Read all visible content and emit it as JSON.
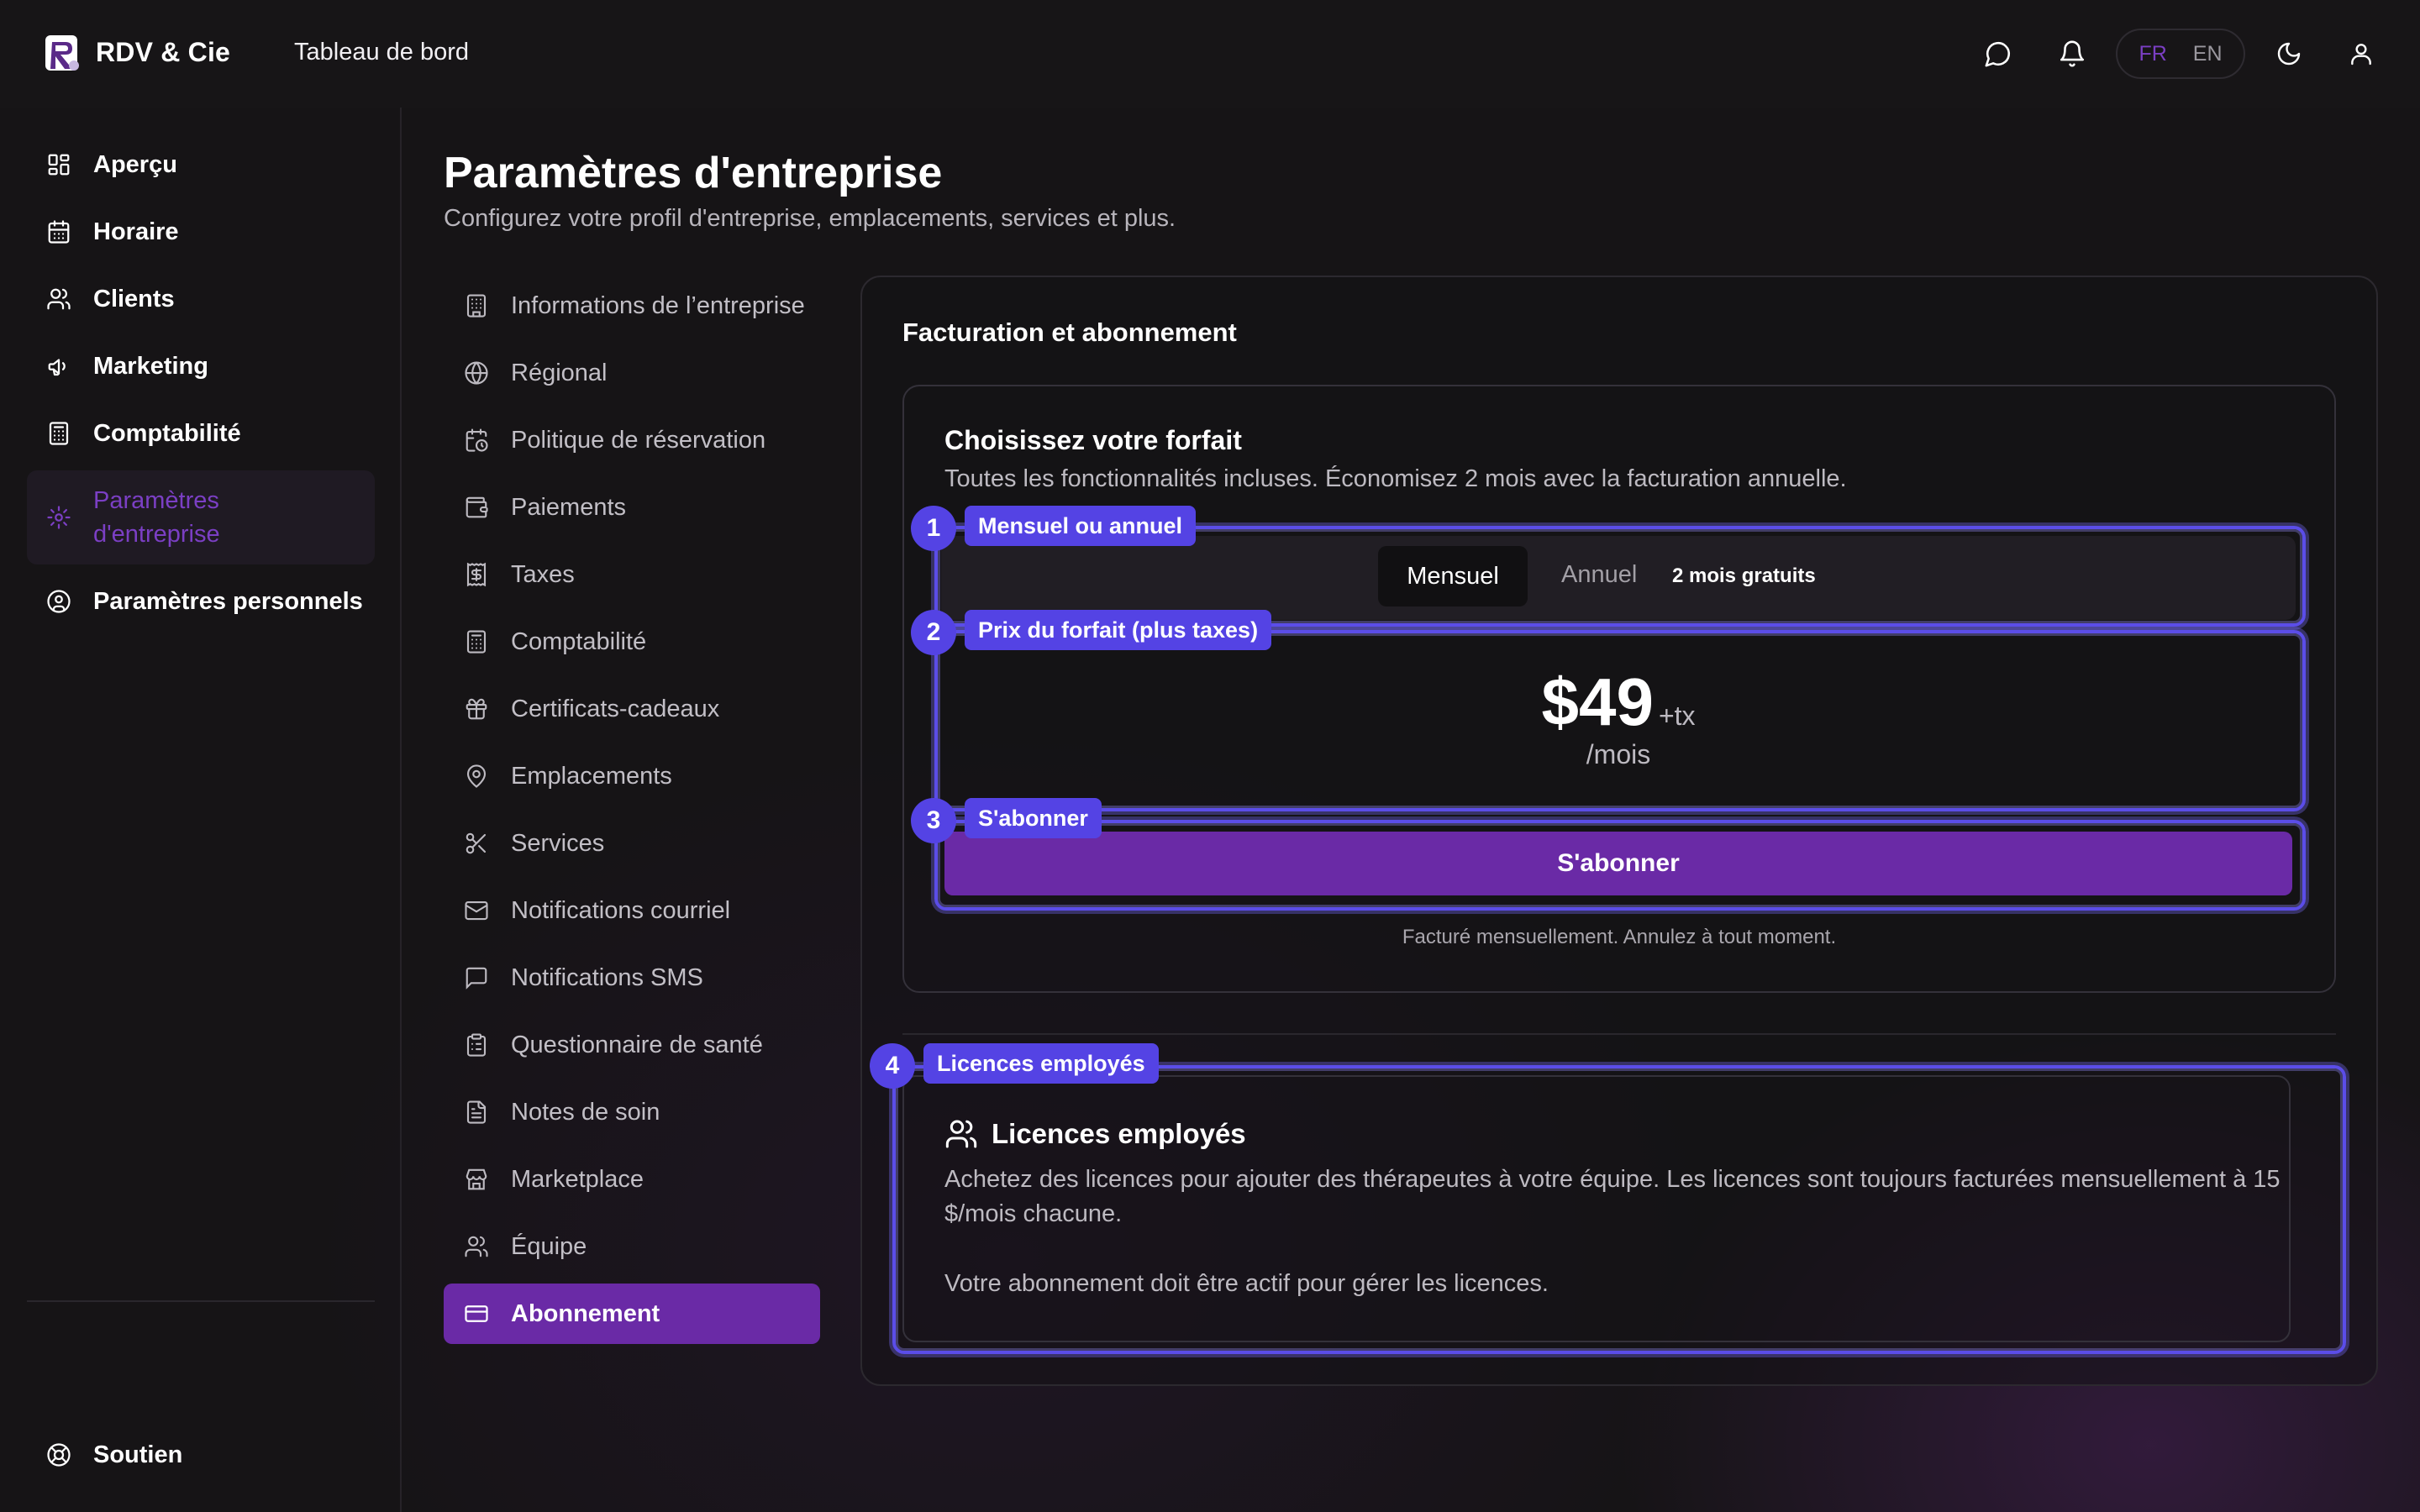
{
  "app": {
    "brand": "RDV & Cie",
    "top_title": "Tableau de bord",
    "lang": {
      "fr": "FR",
      "en": "EN",
      "active": "FR"
    }
  },
  "sidebar": {
    "items": [
      {
        "label": "Aperçu",
        "icon": "dashboard-icon"
      },
      {
        "label": "Horaire",
        "icon": "calendar-icon"
      },
      {
        "label": "Clients",
        "icon": "users-icon"
      },
      {
        "label": "Marketing",
        "icon": "megaphone-icon"
      },
      {
        "label": "Comptabilité",
        "icon": "calculator-icon"
      },
      {
        "label": "Paramètres d'entreprise",
        "icon": "gear-icon",
        "active": true
      },
      {
        "label": "Paramètres personnels",
        "icon": "user-circle-icon"
      }
    ],
    "support": "Soutien"
  },
  "page": {
    "title": "Paramètres d'entreprise",
    "subtitle": "Configurez votre profil d'entreprise, emplacements, services et plus."
  },
  "settings_nav": [
    {
      "label": "Informations de l’entreprise",
      "icon": "building-icon"
    },
    {
      "label": "Régional",
      "icon": "globe-icon"
    },
    {
      "label": "Politique de réservation",
      "icon": "calendar-clock-icon"
    },
    {
      "label": "Paiements",
      "icon": "wallet-icon"
    },
    {
      "label": "Taxes",
      "icon": "receipt-dollar-icon"
    },
    {
      "label": "Comptabilité",
      "icon": "calculator-icon"
    },
    {
      "label": "Certificats-cadeaux",
      "icon": "gift-icon"
    },
    {
      "label": "Emplacements",
      "icon": "map-pin-icon"
    },
    {
      "label": "Services",
      "icon": "scissors-icon"
    },
    {
      "label": "Notifications courriel",
      "icon": "mail-icon"
    },
    {
      "label": "Notifications SMS",
      "icon": "message-square-icon"
    },
    {
      "label": "Questionnaire de santé",
      "icon": "clipboard-icon"
    },
    {
      "label": "Notes de soin",
      "icon": "file-text-icon"
    },
    {
      "label": "Marketplace",
      "icon": "store-icon"
    },
    {
      "label": "Équipe",
      "icon": "users-icon"
    },
    {
      "label": "Abonnement",
      "icon": "credit-card-icon",
      "active": true
    }
  ],
  "billing": {
    "title": "Facturation et abonnement",
    "plan": {
      "title": "Choisissez votre forfait",
      "description": "Toutes les fonctionnalités incluses. Économisez 2 mois avec la facturation annuelle.",
      "toggle": {
        "monthly": "Mensuel",
        "annual": "Annuel",
        "annual_badge": "2 mois gratuits",
        "selected": "Mensuel"
      },
      "price": "$49",
      "tax": "+tx",
      "period": "/mois",
      "subscribe": "S'abonner",
      "note": "Facturé mensuellement. Annulez à tout moment."
    },
    "licenses": {
      "title": "Licences employés",
      "description": "Achetez des licences pour ajouter des thérapeutes à votre équipe. Les licences sont toujours facturées mensuellement à 15 $/mois chacune.",
      "note": "Votre abonnement doit être actif pour gérer les licences."
    }
  },
  "highlights": [
    {
      "number": "1",
      "label": "Mensuel ou annuel"
    },
    {
      "number": "2",
      "label": "Prix du forfait (plus taxes)"
    },
    {
      "number": "3",
      "label": "S'abonner"
    },
    {
      "number": "4",
      "label": "Licences employés"
    }
  ],
  "colors": {
    "accent": "#6A2AA6",
    "accent_text": "#7B3FC4",
    "highlight": "#5443E4",
    "background": "#161416"
  }
}
